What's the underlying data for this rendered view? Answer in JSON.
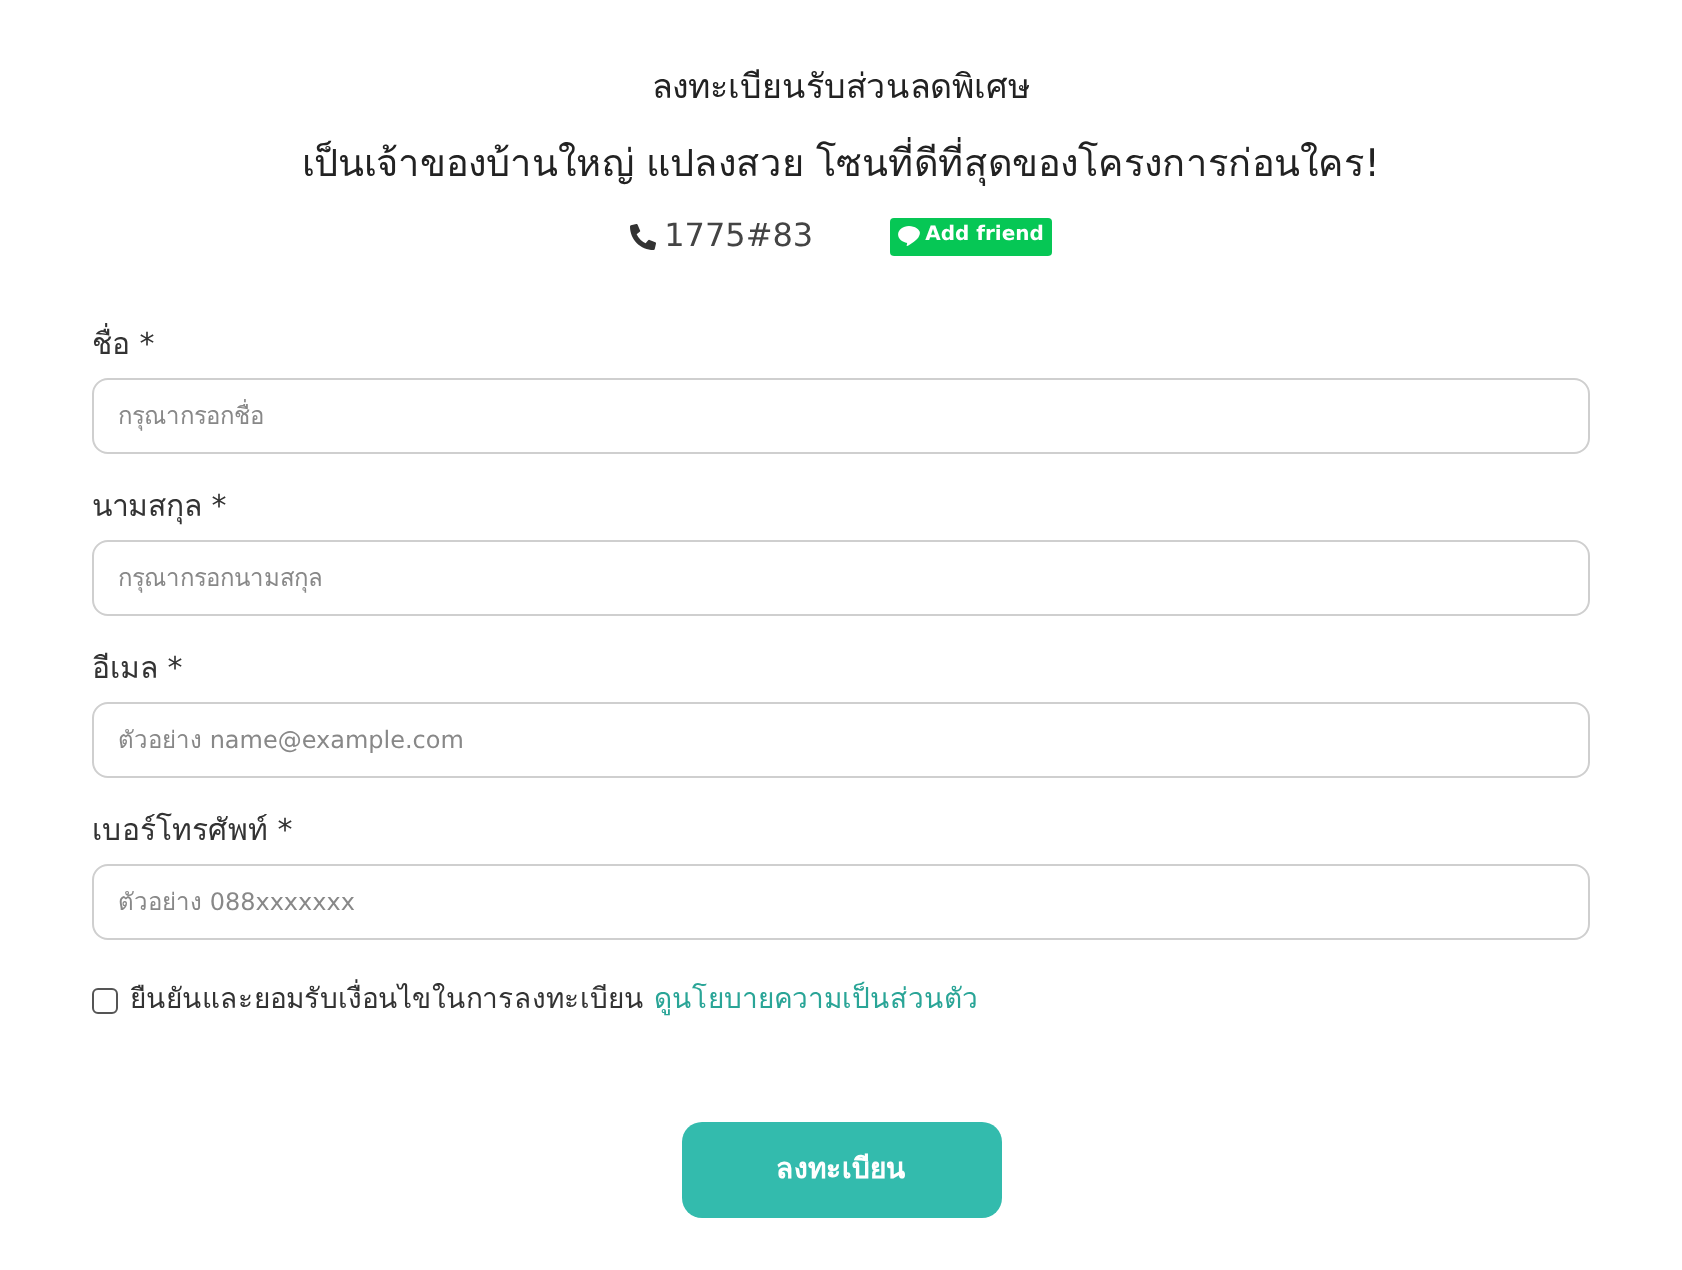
{
  "header": {
    "title": "ลงทะเบียนรับส่วนลดพิเศษ",
    "subtitle": "เป็นเจ้าของบ้านใหญ่ แปลงสวย โซนที่ดีที่สุดของโครงการก่อนใคร!",
    "phone": "1775#83",
    "line_button": "Add friend"
  },
  "fields": [
    {
      "label": "ชื่อ *",
      "placeholder": "กรุณากรอกชื่อ"
    },
    {
      "label": "นามสกุล *",
      "placeholder": "กรุณากรอกนามสกุล"
    },
    {
      "label": "อีเมล *",
      "placeholder": "ตัวอย่าง name@example.com"
    },
    {
      "label": "เบอร์โทรศัพท์ *",
      "placeholder": "ตัวอย่าง 088xxxxxxx"
    }
  ],
  "consent": {
    "checked": false,
    "text": "ยืนยันและยอมรับเงื่อนไขในการลงทะเบียน",
    "link": "ดูนโยบายความเป็นส่วนตัว"
  },
  "submit": "ลงทะเบียน"
}
